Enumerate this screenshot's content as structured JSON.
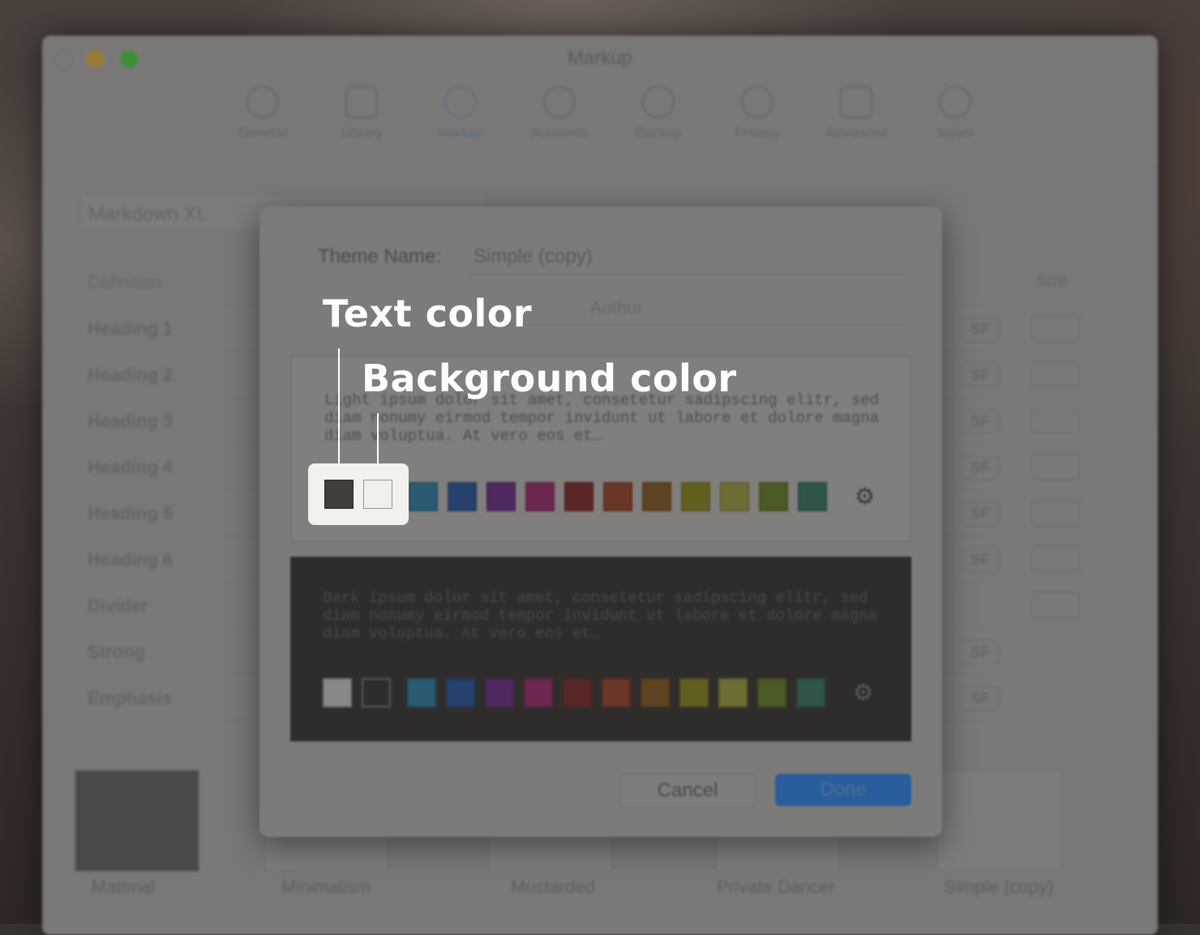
{
  "window": {
    "title": "Markup",
    "toolbar": [
      {
        "label": "General",
        "icon": "gear-icon"
      },
      {
        "label": "Library",
        "icon": "library-icon"
      },
      {
        "label": "Markup",
        "icon": "markup-icon",
        "active": true
      },
      {
        "label": "Accounts",
        "icon": "accounts-icon"
      },
      {
        "label": "Backup",
        "icon": "backup-icon"
      },
      {
        "label": "Privacy",
        "icon": "privacy-icon"
      },
      {
        "label": "Advanced",
        "icon": "advanced-icon"
      },
      {
        "label": "Styles",
        "icon": "styles-icon"
      }
    ],
    "markdown_field": "Markdown XL",
    "definitions": {
      "header": "Definition",
      "size_header": "Size",
      "rows": [
        "Heading 1",
        "Heading 2",
        "Heading 3",
        "Heading 4",
        "Heading 5",
        "Heading 6",
        "Divider",
        "Strong",
        "Emphasis"
      ],
      "sf_label": "SF"
    },
    "themes": [
      "Material",
      "Minimalism",
      "Mustarded",
      "Private Dancer",
      "Simple (copy)"
    ]
  },
  "sheet": {
    "theme_name_label": "Theme Name:",
    "theme_name_value": "Simple (copy)",
    "author_value": "Author",
    "light_preview_text": "Light ipsum dolor sit amet, consetetur sadipscing elitr, sed diam nonumy eirmod tempor invidunt ut labore et dolore magna diam voluptua. At vero eos et…",
    "dark_preview_text": "Dark ipsum dolor sit amet, consetetur sadipscing elitr, sed diam nonumy eirmod tempor invidunt ut labore et dolore magna diam voluptua. At vero eos et…",
    "light_base_swatches": [
      "#3f3a36",
      "#ecebe7"
    ],
    "dark_base_swatches": [
      "#8a8886",
      "#2f2d2c"
    ],
    "accent_swatches": [
      "#2a5b72",
      "#27426e",
      "#4e2a60",
      "#6c284f",
      "#5a2727",
      "#6a3727",
      "#5e4421",
      "#626021",
      "#6e6d34",
      "#4c5a25",
      "#2e5548"
    ],
    "cancel_label": "Cancel",
    "done_label": "Done"
  },
  "popover": {
    "text_color_swatch": "#433d39",
    "background_color_swatch": "#f1efea"
  },
  "callouts": {
    "text_color": "Text color",
    "background_color": "Background color"
  }
}
